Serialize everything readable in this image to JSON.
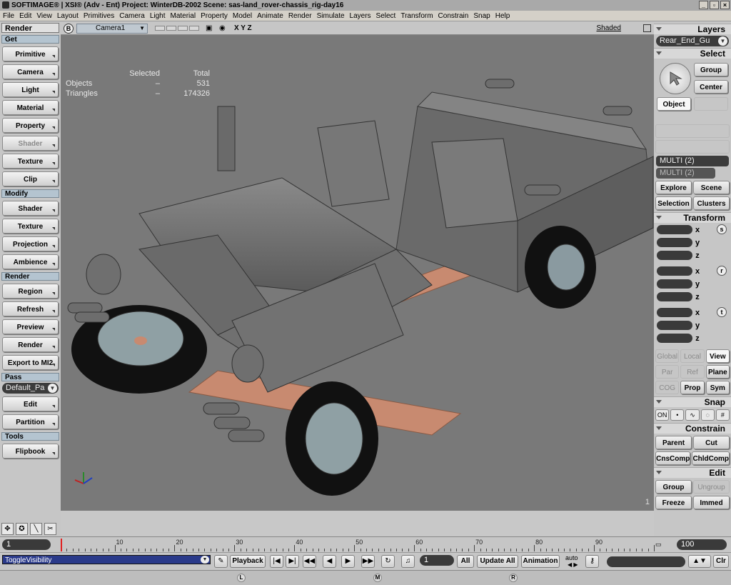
{
  "title": "SOFTIMAGE® | XSI® (Adv - Ent) Project: WinterDB-2002    Scene: sas-land_rover-chassis_rig-day16",
  "menu": [
    "File",
    "Edit",
    "View",
    "Layout",
    "Primitives",
    "Camera",
    "Light",
    "Material",
    "Property",
    "Model",
    "Animate",
    "Render",
    "Simulate",
    "Layers",
    "Select",
    "Transform",
    "Constrain",
    "Snap",
    "Help"
  ],
  "left": {
    "header": "Render",
    "get": {
      "title": "Get",
      "buttons": [
        "Primitive",
        "Camera",
        "Light",
        "Material",
        "Property",
        "Shader",
        "Texture",
        "Clip"
      ]
    },
    "modify": {
      "title": "Modify",
      "buttons": [
        "Shader",
        "Texture",
        "Projection",
        "Ambience"
      ]
    },
    "render": {
      "title": "Render",
      "buttons": [
        "Region",
        "Refresh",
        "Preview",
        "Render",
        "Export to MI2"
      ]
    },
    "pass": {
      "title": "Pass",
      "dropdown": "Default_Pa",
      "buttons": [
        "Edit",
        "Partition"
      ]
    },
    "tools": {
      "title": "Tools",
      "buttons": [
        "Flipbook"
      ]
    }
  },
  "viewport": {
    "letter": "B",
    "camera": "Camera1",
    "axes_label": "X Y Z",
    "mode": "Shaded",
    "stats": {
      "selected_label": "Selected",
      "total_label": "Total",
      "objects_label": "Objects",
      "objects_selected": "–",
      "objects_total": "531",
      "triangles_label": "Triangles",
      "triangles_selected": "–",
      "triangles_total": "174326"
    },
    "page": "1"
  },
  "right": {
    "layers_title": "Layers",
    "layer_dropdown": "Rear_End_Gu",
    "select_title": "Select",
    "select_buttons": {
      "group": "Group",
      "center": "Center",
      "object": "Object"
    },
    "multi1": "MULTI (2)",
    "multi2": "MULTI (2)",
    "explore": "Explore",
    "scene": "Scene",
    "selection": "Selection",
    "clusters": "Clusters",
    "transform_title": "Transform",
    "axes": [
      "x",
      "y",
      "z"
    ],
    "xf_icons": [
      "s",
      "r",
      "t"
    ],
    "global": "Global",
    "local": "Local",
    "view": "View",
    "par": "Par",
    "ref": "Ref",
    "plane": "Plane",
    "cog": "COG",
    "prop": "Prop",
    "sym": "Sym",
    "snap_title": "Snap",
    "snap_on": "ON",
    "constrain_title": "Constrain",
    "parent": "Parent",
    "cut": "Cut",
    "cnscomp": "CnsComp",
    "chldcomp": "ChldComp",
    "edit_title": "Edit",
    "group": "Group",
    "ungroup": "Ungroup",
    "freeze": "Freeze",
    "immed": "Immed"
  },
  "timeline": {
    "start": "1",
    "end": "100",
    "ticks": [
      "10",
      "20",
      "30",
      "40",
      "50",
      "60",
      "70",
      "80",
      "90"
    ],
    "tick_values": [
      10,
      20,
      30,
      40,
      50,
      60,
      70,
      80,
      90
    ],
    "current": 1,
    "max": 100
  },
  "bottom": {
    "command": "ToggleVisibility",
    "playback": "Playback",
    "frame": "1",
    "all": "All",
    "update_all": "Update All",
    "animation": "Animation",
    "auto": "auto",
    "clr": "Clr"
  },
  "status": {
    "l": "L",
    "m": "M",
    "r": "R"
  },
  "colors": {
    "viewport_bg": "#797979",
    "mesh": "#6d6d6d",
    "frame": "#c88a70",
    "cmd_bg": "#2a3a8a"
  }
}
